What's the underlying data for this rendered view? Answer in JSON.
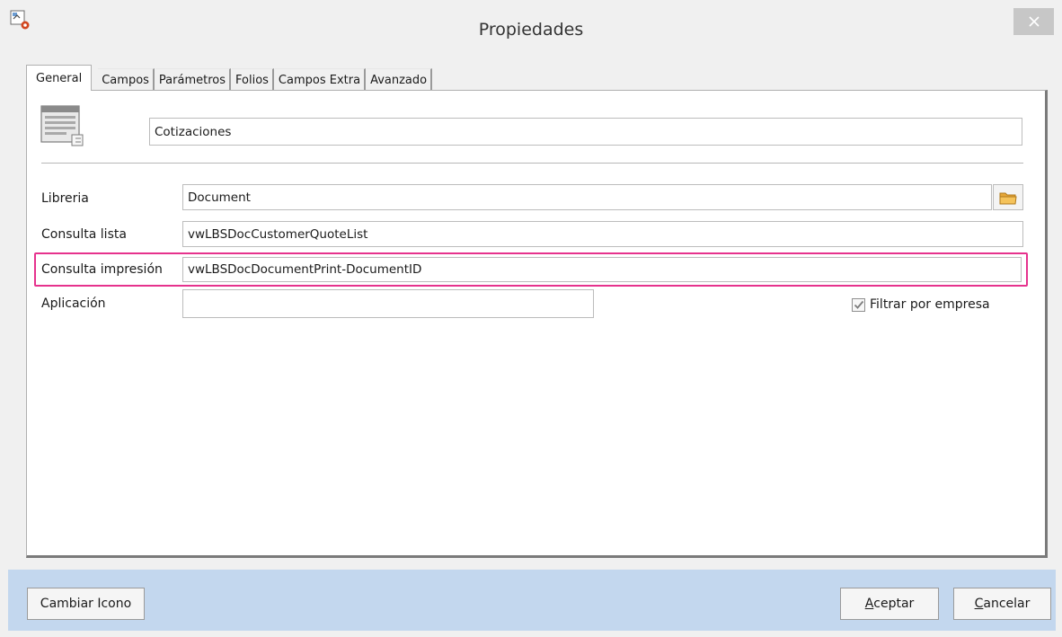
{
  "window": {
    "title": "Propiedades",
    "close_icon": "close-icon"
  },
  "tabs": [
    {
      "label": "General",
      "active": true
    },
    {
      "label": "Campos",
      "active": false
    },
    {
      "label": "Parámetros",
      "active": false
    },
    {
      "label": "Folios",
      "active": false
    },
    {
      "label": "Campos Extra",
      "active": false
    },
    {
      "label": "Avanzado",
      "active": false
    }
  ],
  "general": {
    "form_icon": "form-window-icon",
    "name_value": "Cotizaciones",
    "fields": {
      "libreria": {
        "label": "Libreria",
        "value": "Document",
        "browse_icon": "folder-icon"
      },
      "consulta_lista": {
        "label": "Consulta lista",
        "value": "vwLBSDocCustomerQuoteList"
      },
      "consulta_impresion": {
        "label": "Consulta impresión",
        "value": "vwLBSDocDocumentPrint-DocumentID",
        "highlight_color": "#e6328d"
      },
      "aplicacion": {
        "label": "Aplicación",
        "value": ""
      }
    },
    "filter_checkbox": {
      "label": "Filtrar por empresa",
      "checked": true
    }
  },
  "footer": {
    "change_icon_label": "Cambiar Icono",
    "accept_mnemonic": "A",
    "accept_rest": "ceptar",
    "cancel_mnemonic": "C",
    "cancel_rest": "ancelar"
  },
  "colors": {
    "footer_bg": "#c3d7ee",
    "highlight": "#e6328d",
    "close_button": "#c7c7c7"
  }
}
